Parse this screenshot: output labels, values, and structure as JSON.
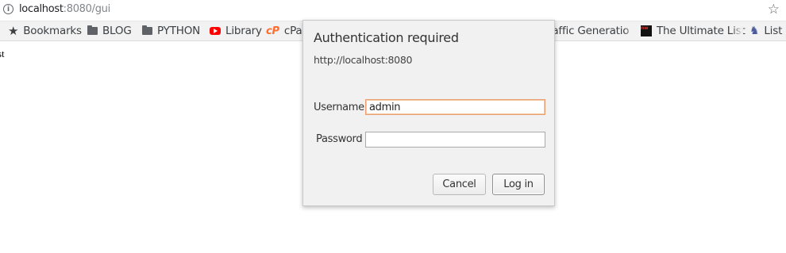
{
  "browser": {
    "url_host": "localhost",
    "url_rest": ":8080/gui",
    "info_icon": "i",
    "star_icon": "☆"
  },
  "bookmarks": [
    {
      "label": "Bookmarks",
      "icon": "star"
    },
    {
      "label": "BLOG",
      "icon": "folder"
    },
    {
      "label": "PYTHON",
      "icon": "folder"
    },
    {
      "label": "Library",
      "icon": "youtube"
    },
    {
      "label": "cPar",
      "icon": "cpanel"
    },
    {
      "label": "raffic Generatio",
      "icon": "none"
    },
    {
      "label": "The Ultimate List",
      "icon": "tw"
    },
    {
      "label": "List",
      "icon": "list"
    }
  ],
  "page": {
    "text": "st"
  },
  "auth_dialog": {
    "title": "Authentication required",
    "origin": "http://localhost:8080",
    "username_label": "Username",
    "username_value": "admin",
    "password_label": "Password",
    "password_value": "",
    "cancel_label": "Cancel",
    "login_label": "Log in"
  },
  "colors": {
    "focus_border": "#e8a070",
    "dialog_bg": "#f1f1f1",
    "youtube_red": "#ff0000",
    "cpanel_orange": "#ff6c2c"
  }
}
